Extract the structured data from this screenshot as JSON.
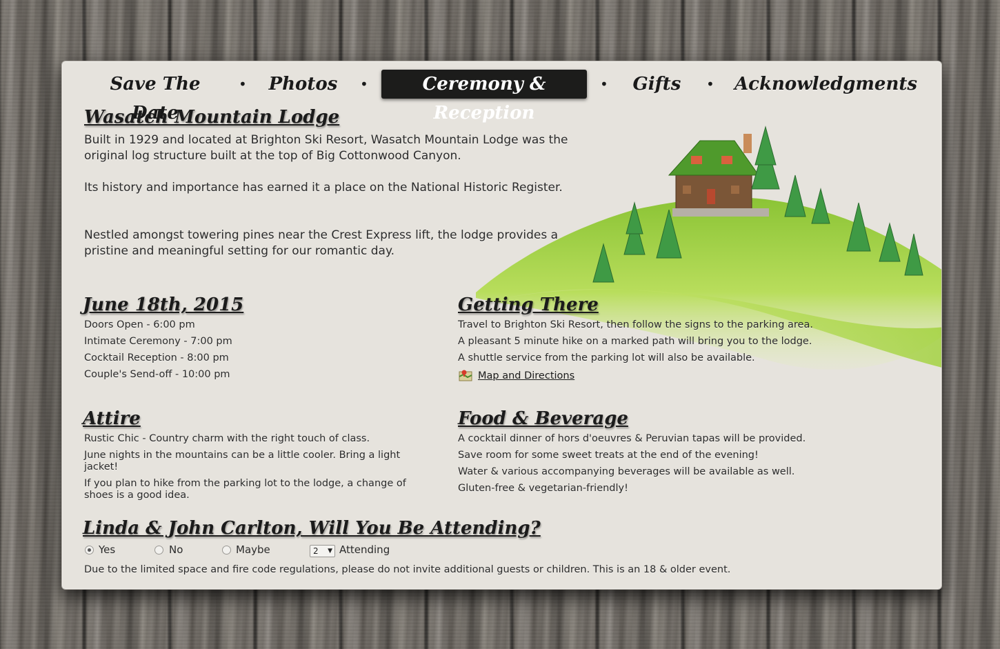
{
  "nav": {
    "items": [
      {
        "label": "Save The Date",
        "active": false
      },
      {
        "label": "Photos",
        "active": false
      },
      {
        "label": "Ceremony & Reception",
        "active": true
      },
      {
        "label": "Gifts",
        "active": false
      },
      {
        "label": "Acknowledgments",
        "active": false
      }
    ],
    "separator": "•"
  },
  "lodge": {
    "title": "Wasatch Mountain Lodge",
    "paragraphs": [
      "Built in 1929 and located at Brighton Ski Resort, Wasatch Mountain Lodge was the original log structure built at the top of Big Cottonwood Canyon.",
      "Its history and importance has earned it a place on the National Historic Register.",
      "Nestled amongst towering pines near the Crest Express lift, the lodge provides a pristine and meaningful setting for our romantic day."
    ]
  },
  "schedule": {
    "title": "June 18th, 2015",
    "items": [
      "Doors Open - 6:00 pm",
      "Intimate Ceremony - 7:00 pm",
      "Cocktail Reception - 8:00 pm",
      "Couple's Send-off - 10:00 pm"
    ]
  },
  "getting_there": {
    "title": "Getting There",
    "items": [
      "Travel to Brighton Ski Resort, then follow the signs to the parking area.",
      "A pleasant 5 minute hike on a marked path will bring you to the lodge.",
      "A shuttle service from the parking lot will also be available."
    ],
    "map_link": "Map and Directions",
    "map_icon": "map-icon"
  },
  "attire": {
    "title": "Attire",
    "items": [
      "Rustic Chic - Country charm with the right touch of class.",
      "June nights in the mountains can be a little cooler. Bring a light jacket!",
      "If you plan to hike from the parking lot to the lodge, a change of shoes is a good idea."
    ]
  },
  "food": {
    "title": "Food & Beverage",
    "items": [
      "A cocktail dinner of hors d'oeuvres & Peruvian tapas will be provided.",
      "Save room for some sweet treats at the end of the evening!",
      "Water & various accompanying beverages will be available as well.",
      "Gluten-free & vegetarian-friendly!"
    ]
  },
  "rsvp": {
    "title": "Linda & John Carlton, Will You Be Attending?",
    "options": [
      {
        "label": "Yes",
        "checked": true
      },
      {
        "label": "No",
        "checked": false
      },
      {
        "label": "Maybe",
        "checked": false
      }
    ],
    "count_value": "2",
    "count_label": "Attending",
    "note": "Due to the limited space and fire code regulations, please do not invite additional guests or children. This is an 18 & older event."
  },
  "colors": {
    "panel": "#e6e3dd",
    "active_tab": "#1c1c1b",
    "text": "#2b2b2b",
    "hill_green": "#9bd13a"
  }
}
